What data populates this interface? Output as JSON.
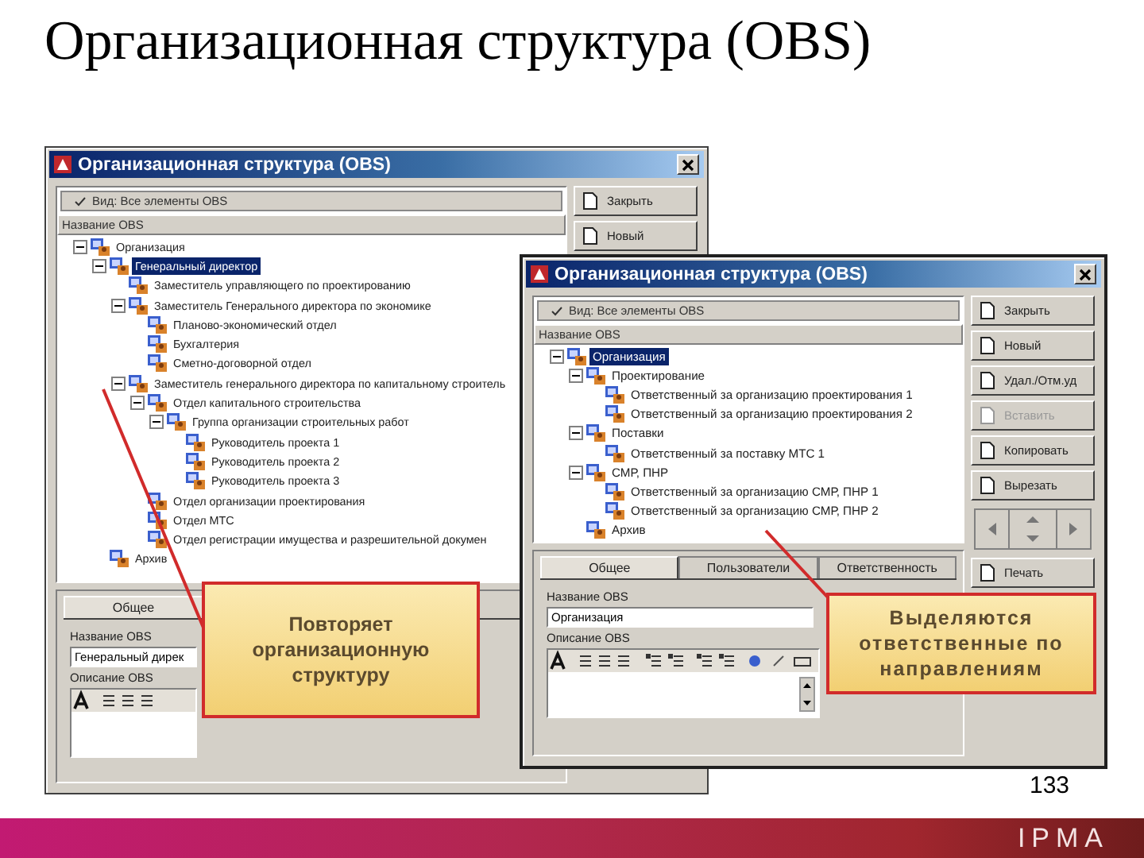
{
  "slide": {
    "title": "Организационная структура (OBS)",
    "page_number": "133",
    "logo": "IPMA"
  },
  "windows": [
    {
      "title": "Организационная структура (OBS)",
      "view_filter": "Вид: Все элементы OBS",
      "column_header": "Название OBS",
      "tree": [
        {
          "label": "Организация",
          "selected": false,
          "children": [
            {
              "label": "Генеральный директор",
              "selected": true,
              "children": [
                {
                  "label": "Заместитель управляющего по проектированию",
                  "selected": false
                },
                {
                  "label": "Заместитель Генерального директора по экономике",
                  "selected": false,
                  "children": [
                    {
                      "label": "Планово-экономический отдел",
                      "selected": false
                    },
                    {
                      "label": "Бухгалтерия",
                      "selected": false
                    },
                    {
                      "label": "Сметно-договорной отдел",
                      "selected": false
                    }
                  ]
                },
                {
                  "label": "Заместитель генерального директора по капитальному строитель",
                  "selected": false,
                  "children": [
                    {
                      "label": "Отдел капитального строительства",
                      "selected": false,
                      "children": [
                        {
                          "label": "Группа организации строительных работ",
                          "selected": false,
                          "children": [
                            {
                              "label": "Руководитель проекта 1",
                              "selected": false
                            },
                            {
                              "label": "Руководитель проекта 2",
                              "selected": false
                            },
                            {
                              "label": "Руководитель проекта 3",
                              "selected": false
                            }
                          ]
                        }
                      ]
                    },
                    {
                      "label": "Отдел организации проектирования",
                      "selected": false
                    },
                    {
                      "label": "Отдел МТС",
                      "selected": false
                    },
                    {
                      "label": "Отдел регистрации имущества и разрешительной докумен",
                      "selected": false
                    }
                  ]
                }
              ]
            },
            {
              "label": "Архив",
              "selected": false
            }
          ]
        }
      ],
      "buttons": [
        {
          "kind": "command",
          "label": "Закрыть",
          "disabled": false
        },
        {
          "kind": "command",
          "label": "Новый",
          "disabled": false
        }
      ],
      "tabs": [
        {
          "label": "Общее",
          "selected": true
        }
      ],
      "name_label": "Название OBS",
      "name_value": "Генеральный дирек",
      "description_label": "Описание OBS"
    },
    {
      "title": "Организационная структура (OBS)",
      "view_filter": "Вид: Все элементы OBS",
      "column_header": "Название OBS",
      "tree": [
        {
          "label": "Организация",
          "selected": true,
          "children": [
            {
              "label": "Проектирование",
              "selected": false,
              "children": [
                {
                  "label": "Ответственный за организацию проектирования 1",
                  "selected": false
                },
                {
                  "label": "Ответственный за организацию проектирования 2",
                  "selected": false
                }
              ]
            },
            {
              "label": "Поставки",
              "selected": false,
              "children": [
                {
                  "label": "Ответственный за поставку МТС 1",
                  "selected": false
                }
              ]
            },
            {
              "label": "СМР, ПНР",
              "selected": false,
              "children": [
                {
                  "label": "Ответственный за организацию СМР, ПНР 1",
                  "selected": false
                },
                {
                  "label": "Ответственный за организацию СМР, ПНР 2",
                  "selected": false
                }
              ]
            },
            {
              "label": "Архив",
              "selected": false
            }
          ]
        }
      ],
      "buttons": [
        {
          "kind": "command",
          "label": "Закрыть",
          "disabled": false
        },
        {
          "kind": "command",
          "label": "Новый",
          "disabled": false
        },
        {
          "kind": "command",
          "label": "Удал./Отм.уд",
          "disabled": false
        },
        {
          "kind": "command",
          "label": "Вставить",
          "disabled": true
        },
        {
          "kind": "command",
          "label": "Копировать",
          "disabled": false
        },
        {
          "kind": "command",
          "label": "Вырезать",
          "disabled": false
        },
        {
          "kind": "nav-pad"
        },
        {
          "kind": "command",
          "label": "Печать",
          "disabled": false
        }
      ],
      "tabs": [
        {
          "label": "Общее",
          "selected": true
        },
        {
          "label": "Пользователи",
          "selected": false
        },
        {
          "label": "Ответственность",
          "selected": false
        }
      ],
      "name_label": "Название OBS",
      "name_value": "Организация",
      "description_label": "Описание OBS"
    }
  ],
  "callouts": [
    {
      "text": "Повторяет организационную структуру"
    },
    {
      "text": "Выделяются ответственные по направлениям"
    }
  ]
}
